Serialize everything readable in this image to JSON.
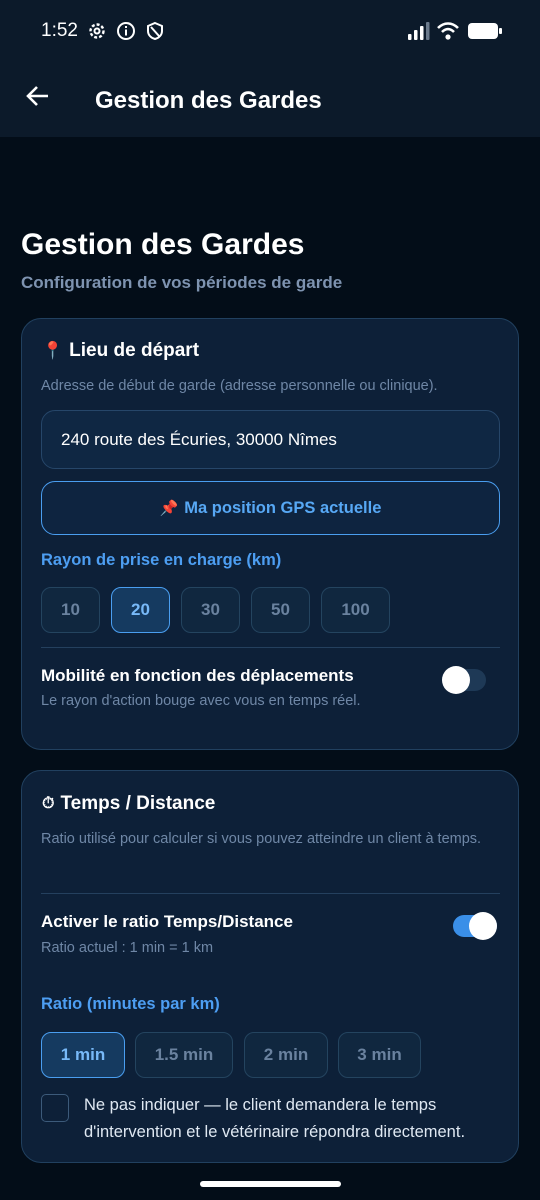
{
  "status_bar": {
    "time": "1:52",
    "left_icons": [
      "gear-icon",
      "info-icon",
      "shield-icon"
    ],
    "right_icons": [
      "signal-icon",
      "wifi-icon",
      "battery-icon"
    ]
  },
  "app_bar": {
    "back_icon": "arrow-left-icon",
    "title": "Gestion des Gardes"
  },
  "page": {
    "title": "Gestion des Gardes",
    "subtitle": "Configuration de vos périodes de garde"
  },
  "departure_card": {
    "emoji": "📍",
    "title": "Lieu de départ",
    "description": "Adresse de début de garde (adresse personnelle ou clinique).",
    "address_value": "240 route des Écuries, 30000 Nîmes",
    "gps_emoji": "📌",
    "gps_button_label": "Ma position GPS actuelle",
    "radius_label": "Rayon de prise en charge (km)",
    "radius_options": [
      "10",
      "20",
      "30",
      "50",
      "100"
    ],
    "radius_selected": "20",
    "mobility_title": "Mobilité en fonction des déplacements",
    "mobility_subtitle": "Le rayon d'action bouge avec vous en temps réel.",
    "mobility_enabled": false
  },
  "time_card": {
    "emoji": "⏱",
    "title": "Temps / Distance",
    "description": "Ratio utilisé pour calculer si vous pouvez atteindre un client à temps.",
    "ratio_toggle_title": "Activer le ratio Temps/Distance",
    "ratio_toggle_subtitle": "Ratio actuel : 1 min = 1 km",
    "ratio_enabled": true,
    "ratio_label": "Ratio (minutes par km)",
    "ratio_options": [
      "1 min",
      "1.5 min",
      "2 min",
      "3 min"
    ],
    "ratio_selected": "1 min",
    "no_indicate_text": "Ne pas indiquer — le client demandera le temps d'intervention et le vétérinaire répondra directement.",
    "no_indicate_checked": false
  },
  "colors": {
    "background": "#030d18",
    "card": "#0d2038",
    "accent": "#4a9ef0",
    "muted_text": "#6f87a6"
  }
}
